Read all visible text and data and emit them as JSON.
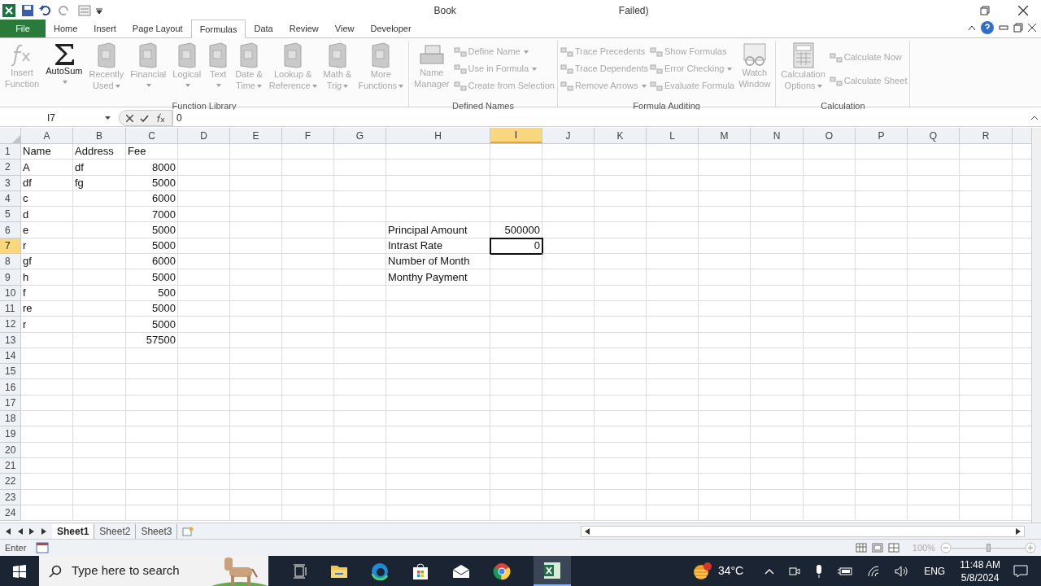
{
  "quick_access": {
    "title_start": "Book",
    "title_end": "Failed)"
  },
  "tabs": [
    {
      "label": "File",
      "kind": "file",
      "selected": false
    },
    {
      "label": "Home",
      "kind": "tab",
      "selected": false
    },
    {
      "label": "Insert",
      "kind": "tab",
      "selected": false
    },
    {
      "label": "Page Layout",
      "kind": "tab",
      "selected": false
    },
    {
      "label": "Formulas",
      "kind": "tab",
      "selected": true
    },
    {
      "label": "Data",
      "kind": "tab",
      "selected": false
    },
    {
      "label": "Review",
      "kind": "tab",
      "selected": false
    },
    {
      "label": "View",
      "kind": "tab",
      "selected": false
    },
    {
      "label": "Developer",
      "kind": "tab",
      "selected": false
    }
  ],
  "ribbon": [
    {
      "name": "Function Library",
      "items": [
        {
          "kind": "large",
          "lines": [
            "Insert",
            "Function"
          ],
          "disabled": true,
          "dropdown": false
        },
        {
          "kind": "large",
          "lines": [
            "AutoSum"
          ],
          "disabled": false,
          "dropdown": true
        },
        {
          "kind": "large",
          "lines": [
            "Recently",
            "Used"
          ],
          "disabled": true,
          "dropdown": true
        },
        {
          "kind": "large",
          "lines": [
            "Financial"
          ],
          "disabled": true,
          "dropdown": true
        },
        {
          "kind": "large",
          "lines": [
            "Logical"
          ],
          "disabled": true,
          "dropdown": true
        },
        {
          "kind": "large",
          "lines": [
            "Text"
          ],
          "disabled": true,
          "dropdown": true
        },
        {
          "kind": "large",
          "lines": [
            "Date &",
            "Time"
          ],
          "disabled": true,
          "dropdown": true
        },
        {
          "kind": "large",
          "lines": [
            "Lookup &",
            "Reference"
          ],
          "disabled": true,
          "dropdown": true
        },
        {
          "kind": "large",
          "lines": [
            "Math &",
            "Trig"
          ],
          "disabled": true,
          "dropdown": true
        },
        {
          "kind": "large",
          "lines": [
            "More",
            "Functions"
          ],
          "disabled": true,
          "dropdown": true
        }
      ]
    },
    {
      "name": "Defined Names",
      "items": [
        {
          "kind": "large",
          "lines": [
            "Name",
            "Manager"
          ],
          "disabled": true,
          "dropdown": false
        },
        {
          "kind": "small",
          "lines": [
            "Define Name"
          ],
          "disabled": true,
          "dropdown": true
        },
        {
          "kind": "small",
          "lines": [
            "Use in Formula"
          ],
          "disabled": true,
          "dropdown": true
        },
        {
          "kind": "small",
          "lines": [
            "Create from Selection"
          ],
          "disabled": true,
          "dropdown": false
        }
      ]
    },
    {
      "name": "Formula Auditing",
      "items": [
        {
          "kind": "small",
          "lines": [
            "Trace Precedents"
          ],
          "disabled": true,
          "dropdown": false
        },
        {
          "kind": "small",
          "lines": [
            "Trace Dependents"
          ],
          "disabled": true,
          "dropdown": false
        },
        {
          "kind": "small",
          "lines": [
            "Remove Arrows"
          ],
          "disabled": true,
          "dropdown": true
        },
        {
          "kind": "small",
          "lines": [
            "Show Formulas"
          ],
          "disabled": true,
          "dropdown": false
        },
        {
          "kind": "small",
          "lines": [
            "Error Checking"
          ],
          "disabled": true,
          "dropdown": true
        },
        {
          "kind": "small",
          "lines": [
            "Evaluate Formula"
          ],
          "disabled": true,
          "dropdown": false
        },
        {
          "kind": "large",
          "lines": [
            "Watch",
            "Window"
          ],
          "disabled": true,
          "dropdown": false
        }
      ]
    },
    {
      "name": "Calculation",
      "items": [
        {
          "kind": "large",
          "lines": [
            "Calculation",
            "Options"
          ],
          "disabled": true,
          "dropdown": true
        },
        {
          "kind": "small",
          "lines": [
            "Calculate Now"
          ],
          "disabled": true,
          "dropdown": false
        },
        {
          "kind": "small",
          "lines": [
            "Calculate Sheet"
          ],
          "disabled": true,
          "dropdown": false
        }
      ]
    }
  ],
  "formula_bar": {
    "name_box": "I7",
    "value": "0"
  },
  "sheet": {
    "columns": [
      {
        "label": "A",
        "selected": false
      },
      {
        "label": "B",
        "selected": false
      },
      {
        "label": "C",
        "selected": false
      },
      {
        "label": "D",
        "selected": false
      },
      {
        "label": "E",
        "selected": false
      },
      {
        "label": "F",
        "selected": false
      },
      {
        "label": "G",
        "selected": false
      },
      {
        "label": "H",
        "selected": false
      },
      {
        "label": "I",
        "selected": true
      },
      {
        "label": "J",
        "selected": false
      },
      {
        "label": "K",
        "selected": false
      },
      {
        "label": "L",
        "selected": false
      },
      {
        "label": "M",
        "selected": false
      },
      {
        "label": "N",
        "selected": false
      },
      {
        "label": "O",
        "selected": false
      },
      {
        "label": "P",
        "selected": false
      },
      {
        "label": "Q",
        "selected": false
      },
      {
        "label": "R",
        "selected": false
      }
    ],
    "rows": [
      {
        "number": "1",
        "selected": false,
        "cells": [
          {
            "text": "Name",
            "kind": "text",
            "selected": false
          },
          {
            "text": "Address",
            "kind": "text",
            "selected": false
          },
          {
            "text": "Fee",
            "kind": "text",
            "selected": false
          }
        ]
      },
      {
        "number": "2",
        "selected": false,
        "cells": [
          {
            "text": "A",
            "kind": "text",
            "selected": false
          },
          {
            "text": "df",
            "kind": "text",
            "selected": false
          },
          {
            "text": "8000",
            "kind": "number",
            "selected": false
          }
        ]
      },
      {
        "number": "3",
        "selected": false,
        "cells": [
          {
            "text": "df",
            "kind": "text",
            "selected": false
          },
          {
            "text": "fg",
            "kind": "text",
            "selected": false
          },
          {
            "text": "5000",
            "kind": "number",
            "selected": false
          }
        ]
      },
      {
        "number": "4",
        "selected": false,
        "cells": [
          {
            "text": "c",
            "kind": "text",
            "selected": false
          },
          null,
          {
            "text": "6000",
            "kind": "number",
            "selected": false
          }
        ]
      },
      {
        "number": "5",
        "selected": false,
        "cells": [
          {
            "text": "d",
            "kind": "text",
            "selected": false
          },
          null,
          {
            "text": "7000",
            "kind": "number",
            "selected": false
          }
        ]
      },
      {
        "number": "6",
        "selected": false,
        "cells": [
          {
            "text": "e",
            "kind": "text",
            "selected": false
          },
          null,
          {
            "text": "5000",
            "kind": "number",
            "selected": false
          },
          null,
          null,
          null,
          null,
          {
            "text": "Principal Amount",
            "kind": "text",
            "selected": false
          },
          {
            "text": "500000",
            "kind": "number",
            "selected": false
          }
        ]
      },
      {
        "number": "7",
        "selected": true,
        "cells": [
          {
            "text": "r",
            "kind": "text",
            "selected": false
          },
          null,
          {
            "text": "5000",
            "kind": "number",
            "selected": false
          },
          null,
          null,
          null,
          null,
          {
            "text": "Intrast Rate",
            "kind": "text",
            "selected": false
          },
          {
            "text": "0",
            "kind": "number",
            "selected": true
          }
        ]
      },
      {
        "number": "8",
        "selected": false,
        "cells": [
          {
            "text": "gf",
            "kind": "text",
            "selected": false
          },
          null,
          {
            "text": "6000",
            "kind": "number",
            "selected": false
          },
          null,
          null,
          null,
          null,
          {
            "text": "Number of Month",
            "kind": "text",
            "selected": false
          }
        ]
      },
      {
        "number": "9",
        "selected": false,
        "cells": [
          {
            "text": "h",
            "kind": "text",
            "selected": false
          },
          null,
          {
            "text": "5000",
            "kind": "number",
            "selected": false
          },
          null,
          null,
          null,
          null,
          {
            "text": "Monthy Payment",
            "kind": "text",
            "selected": false
          }
        ]
      },
      {
        "number": "10",
        "selected": false,
        "cells": [
          {
            "text": "f",
            "kind": "text",
            "selected": false
          },
          null,
          {
            "text": "500",
            "kind": "number",
            "selected": false
          }
        ]
      },
      {
        "number": "11",
        "selected": false,
        "cells": [
          {
            "text": "re",
            "kind": "text",
            "selected": false
          },
          null,
          {
            "text": "5000",
            "kind": "number",
            "selected": false
          }
        ]
      },
      {
        "number": "12",
        "selected": false,
        "cells": [
          {
            "text": "r",
            "kind": "text",
            "selected": false
          },
          null,
          {
            "text": "5000",
            "kind": "number",
            "selected": false
          }
        ]
      },
      {
        "number": "13",
        "selected": false,
        "cells": [
          null,
          null,
          {
            "text": "57500",
            "kind": "number",
            "selected": false
          }
        ]
      },
      {
        "number": "14",
        "selected": false
      },
      {
        "number": "15",
        "selected": false
      },
      {
        "number": "16",
        "selected": false
      },
      {
        "number": "17",
        "selected": false
      },
      {
        "number": "18",
        "selected": false
      },
      {
        "number": "19",
        "selected": false
      },
      {
        "number": "20",
        "selected": false
      },
      {
        "number": "21",
        "selected": false
      },
      {
        "number": "22",
        "selected": false
      },
      {
        "number": "23",
        "selected": false
      },
      {
        "number": "24",
        "selected": false
      }
    ]
  },
  "sheet_tabs": [
    {
      "label": "Sheet1",
      "selected": true
    },
    {
      "label": "Sheet2",
      "selected": false
    },
    {
      "label": "Sheet3",
      "selected": false
    }
  ],
  "status_bar": {
    "mode": "Enter",
    "zoom": "100%",
    "zoom_slider": {
      "level": 0.5
    }
  },
  "taskbar": {
    "search_placeholder": "Type here to search",
    "weather": "34°C",
    "language": "ENG",
    "time": "11:48 AM",
    "date": "5/8/2024"
  }
}
